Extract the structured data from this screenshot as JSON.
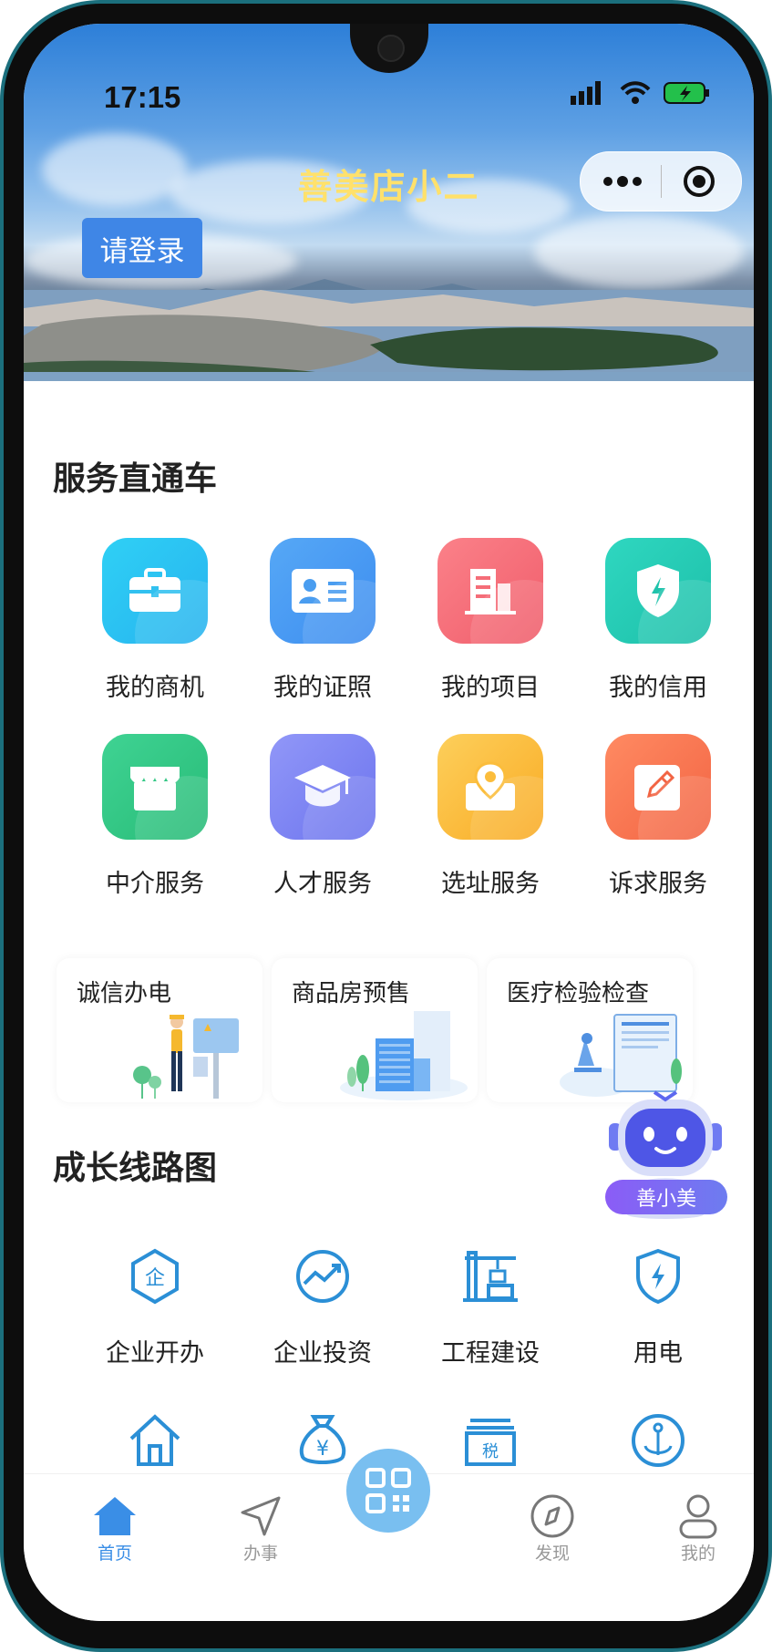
{
  "status_bar": {
    "time": "17:15"
  },
  "header": {
    "app_title": "善美店小二",
    "login_label": "请登录"
  },
  "service_section": {
    "title": "服务直通车",
    "items": [
      {
        "label": "我的商机",
        "icon": "briefcase-icon",
        "color": "#29c3f0"
      },
      {
        "label": "我的证照",
        "icon": "id-card-icon",
        "color": "#4a9df0"
      },
      {
        "label": "我的项目",
        "icon": "building-icon",
        "color": "#f56d78"
      },
      {
        "label": "我的信用",
        "icon": "shield-bolt-icon",
        "color": "#23c9b3"
      },
      {
        "label": "中介服务",
        "icon": "store-icon",
        "color": "#34c785"
      },
      {
        "label": "人才服务",
        "icon": "graduation-cap-icon",
        "color": "#7f86f2"
      },
      {
        "label": "选址服务",
        "icon": "map-pin-icon",
        "color": "#fbbd3c"
      },
      {
        "label": "诉求服务",
        "icon": "edit-icon",
        "color": "#fb7a52"
      }
    ],
    "cards": [
      {
        "label": "诚信办电"
      },
      {
        "label": "商品房预售"
      },
      {
        "label": "医疗检验检查"
      }
    ]
  },
  "assistant": {
    "label": "善小美"
  },
  "growth_section": {
    "title": "成长线路图",
    "items": [
      {
        "label": "企业开办",
        "icon": "enterprise-icon",
        "glyph": "企"
      },
      {
        "label": "企业投资",
        "icon": "trend-up-icon"
      },
      {
        "label": "工程建设",
        "icon": "crane-icon"
      },
      {
        "label": "用电",
        "icon": "shield-bolt-icon"
      }
    ],
    "more_icons": [
      {
        "icon": "house-icon"
      },
      {
        "icon": "money-bag-icon",
        "glyph": "¥"
      },
      {
        "icon": "tax-icon",
        "glyph": "税"
      },
      {
        "icon": "anchor-icon"
      }
    ]
  },
  "tabbar": {
    "tabs": [
      {
        "label": "首页",
        "icon": "home-icon",
        "active": true
      },
      {
        "label": "办事",
        "icon": "send-icon",
        "active": false
      },
      {
        "label": "",
        "icon": "qr-code-icon",
        "active": false
      },
      {
        "label": "发现",
        "icon": "compass-icon",
        "active": false
      },
      {
        "label": "我的",
        "icon": "user-icon",
        "active": false
      }
    ],
    "active_color": "#3a8ee6"
  }
}
